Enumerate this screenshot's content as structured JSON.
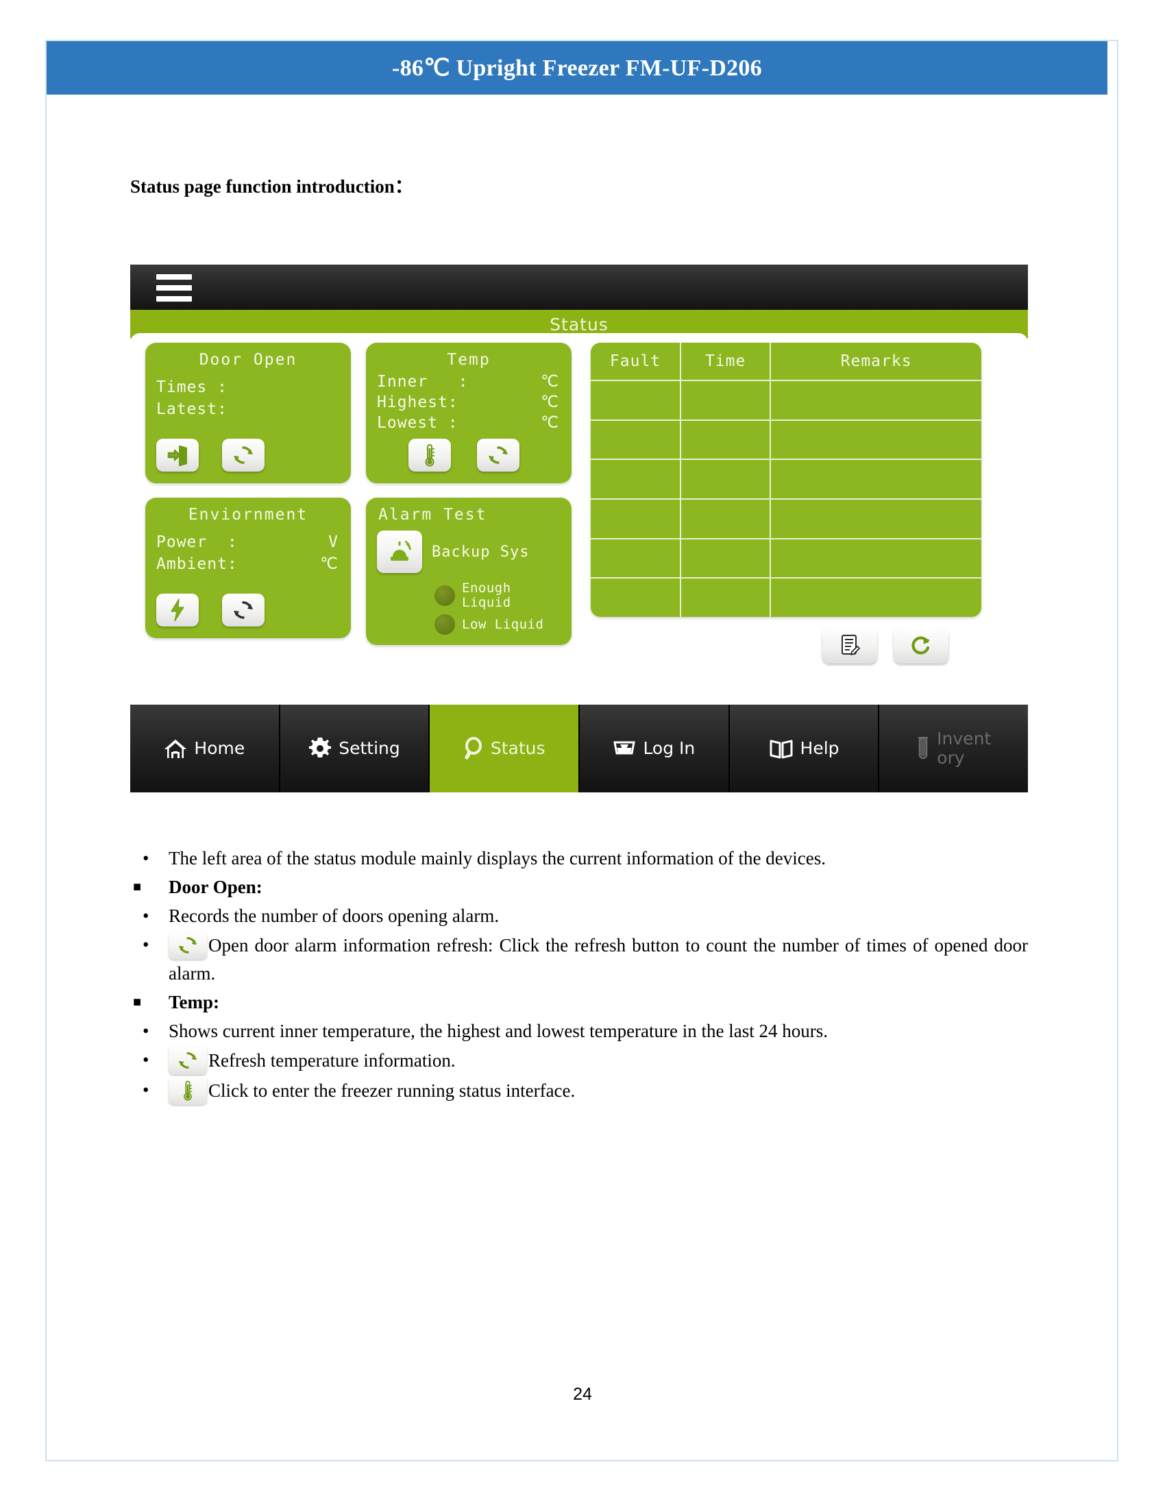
{
  "document": {
    "header_title": "-86℃ Upright Freezer FM-UF-D206",
    "section_heading": "Status page function introduction：",
    "page_number": "24"
  },
  "device_ui": {
    "menu_icon": "hamburger-menu-icon",
    "status_bar_title": "Status",
    "panels": {
      "door_open": {
        "title": "Door Open",
        "rows": [
          {
            "label": "Times :",
            "value": "",
            "unit": ""
          },
          {
            "label": "Latest:",
            "value": "",
            "unit": ""
          }
        ],
        "buttons": [
          {
            "name": "door-enter-icon",
            "label": ""
          },
          {
            "name": "refresh-icon",
            "label": ""
          }
        ]
      },
      "temp": {
        "title": "Temp",
        "rows": [
          {
            "label": "Inner   :",
            "value": "",
            "unit": "℃"
          },
          {
            "label": "Highest:",
            "value": "",
            "unit": "℃"
          },
          {
            "label": "Lowest :",
            "value": "",
            "unit": "℃"
          }
        ],
        "buttons": [
          {
            "name": "thermometer-icon",
            "label": ""
          },
          {
            "name": "refresh-icon",
            "label": ""
          }
        ]
      },
      "enviornment": {
        "title": "Enviornment",
        "rows": [
          {
            "label": "Power  :",
            "value": "",
            "unit": "V"
          },
          {
            "label": "Ambient:",
            "value": "",
            "unit": "℃"
          }
        ],
        "buttons": [
          {
            "name": "lightning-bolt-icon",
            "label": ""
          },
          {
            "name": "refresh-icon",
            "label": ""
          }
        ]
      },
      "alarm_test": {
        "title": "Alarm Test",
        "backup_label": "Backup Sys",
        "alarm_icon": "alarm-siren-icon",
        "indicators": [
          {
            "label": "Enough\nLiquid",
            "state": "off"
          },
          {
            "label": "Low Liquid",
            "state": "off"
          }
        ]
      }
    },
    "fault_table": {
      "columns": [
        "Fault",
        "Time",
        "Remarks"
      ],
      "rows": [
        [
          "",
          "",
          ""
        ],
        [
          "",
          "",
          ""
        ],
        [
          "",
          "",
          ""
        ],
        [
          "",
          "",
          ""
        ],
        [
          "",
          "",
          ""
        ],
        [
          "",
          "",
          ""
        ]
      ],
      "actions": [
        {
          "name": "edit-record-icon",
          "label": ""
        },
        {
          "name": "reload-arrow-icon",
          "label": ""
        }
      ]
    },
    "nav": [
      {
        "label": "Home",
        "icon": "home-icon",
        "active": false,
        "disabled": false
      },
      {
        "label": "Setting",
        "icon": "gear-icon",
        "active": false,
        "disabled": false
      },
      {
        "label": "Status",
        "icon": "magnifier-icon",
        "active": true,
        "disabled": false
      },
      {
        "label": "Log In",
        "icon": "inbox-tray-icon",
        "active": false,
        "disabled": false
      },
      {
        "label": "Help",
        "icon": "open-book-icon",
        "active": false,
        "disabled": false
      },
      {
        "label": "Invent\nory",
        "icon": "test-tube-icon",
        "active": false,
        "disabled": true
      }
    ]
  },
  "bullets": [
    {
      "marker": "dot",
      "bold": false,
      "icon": null,
      "text": "The left area of the status module mainly displays the current information of the devices."
    },
    {
      "marker": "square",
      "bold": true,
      "icon": null,
      "text": "Door Open:"
    },
    {
      "marker": "dot",
      "bold": false,
      "icon": null,
      "text": "Records the number of doors opening alarm."
    },
    {
      "marker": "dot",
      "bold": false,
      "icon": "refresh-icon",
      "text": "Open door alarm information refresh: Click the refresh button to count the number of times of opened door alarm."
    },
    {
      "marker": "square",
      "bold": true,
      "icon": null,
      "text": "Temp:"
    },
    {
      "marker": "dot",
      "bold": false,
      "icon": null,
      "text": "Shows current inner temperature, the highest and lowest temperature in the last 24 hours."
    },
    {
      "marker": "dot",
      "bold": false,
      "icon": "refresh-icon",
      "text": "Refresh temperature information."
    },
    {
      "marker": "dot",
      "bold": false,
      "icon": "thermometer-icon",
      "text": "Click to enter the freezer running status interface."
    }
  ],
  "colors": {
    "banner_blue": "#2f78bd",
    "panel_green": "#8cb720",
    "statusbar_green": "#8cb313",
    "nav_dark": "#1c1c1c",
    "page_border": "#cfe0f2"
  }
}
